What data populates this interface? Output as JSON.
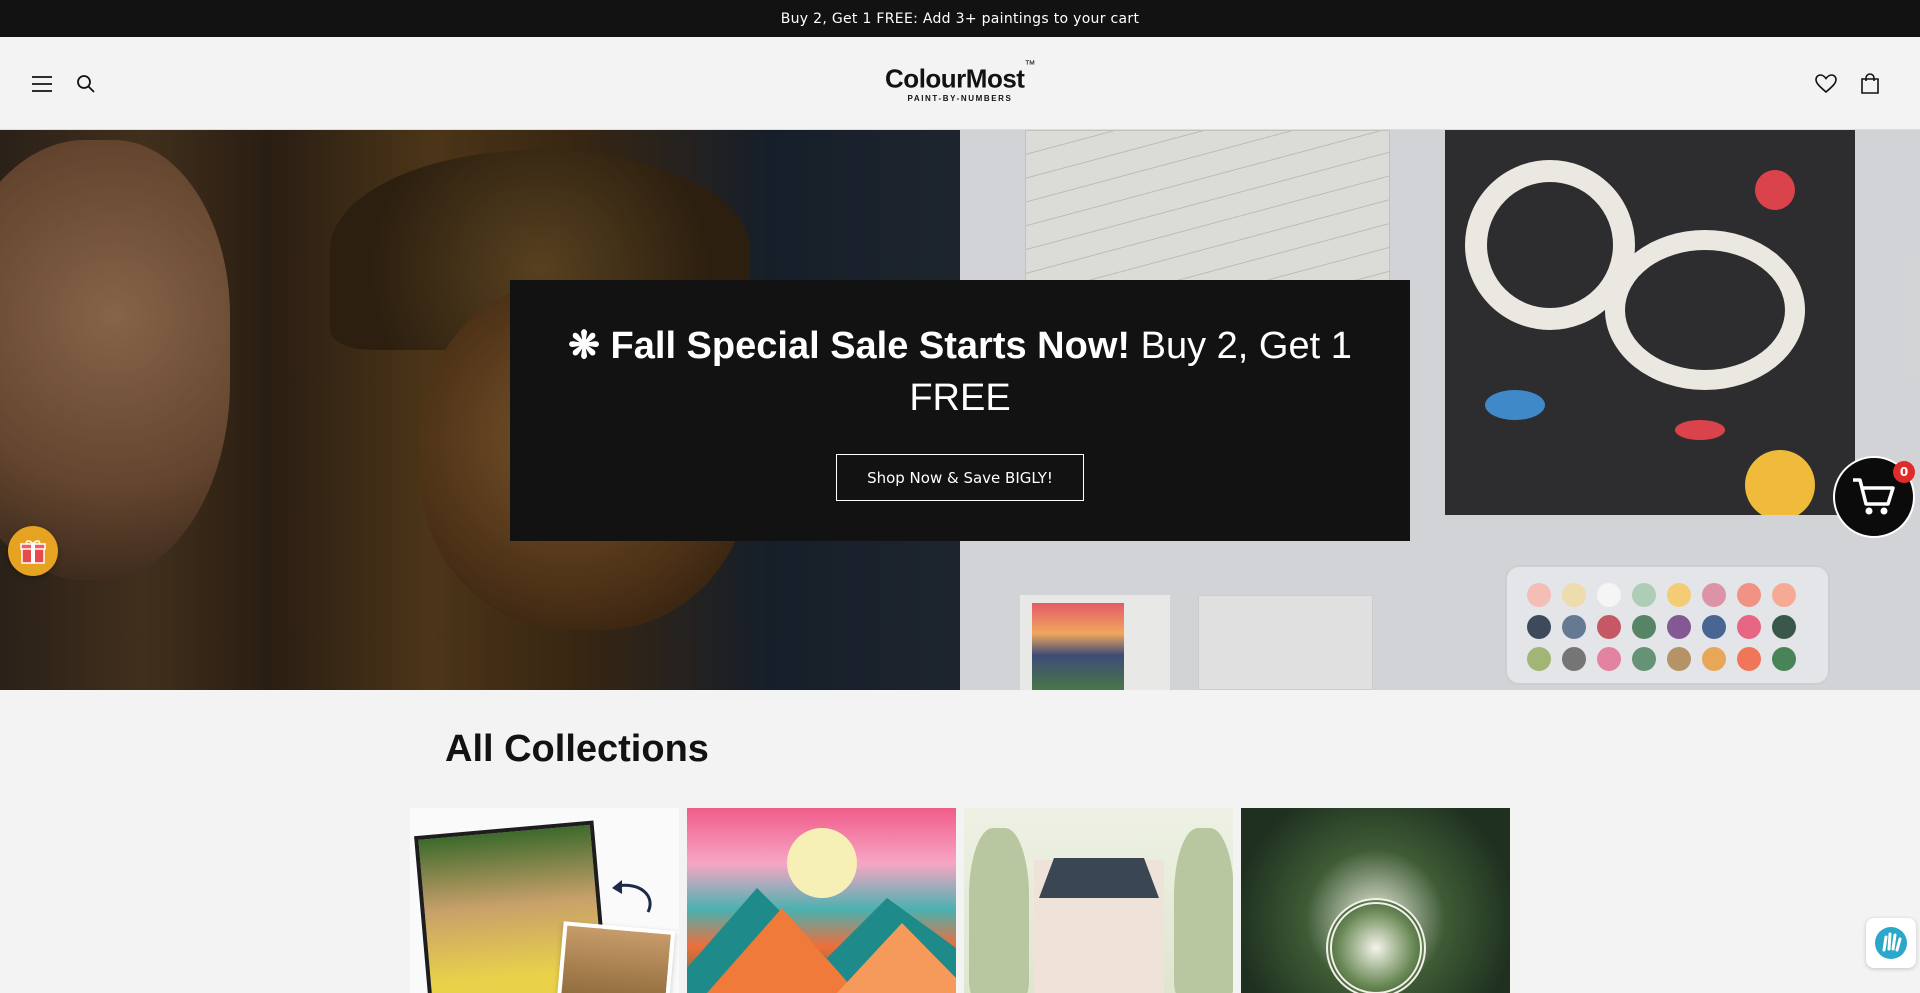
{
  "announcement": {
    "text": "Buy 2, Get 1 FREE: Add 3+ paintings to your cart"
  },
  "header": {
    "logo_brand": "ColourMost",
    "logo_tm": "™",
    "logo_tagline": "PAINT-BY-NUMBERS",
    "icons": [
      "menu-icon",
      "search-icon",
      "heart-icon",
      "cart-icon"
    ]
  },
  "hero": {
    "title_bold": "❋ Fall Special Sale Starts Now!",
    "title_normal": " Buy 2, Get 1 FREE",
    "button_label": "Shop Now & Save BIGLY!"
  },
  "floating": {
    "cart_count": "0",
    "gift_icon": "gift-icon",
    "accessibility_icon": "accessibility-hand-icon"
  },
  "collections": {
    "title": "All Collections"
  },
  "colors": {
    "announcement_bg": "#121212",
    "page_bg": "#f3f3f3",
    "hero_box_bg": "#121212",
    "gift_bg": "#e6a321",
    "badge_bg": "#e02b2b"
  }
}
